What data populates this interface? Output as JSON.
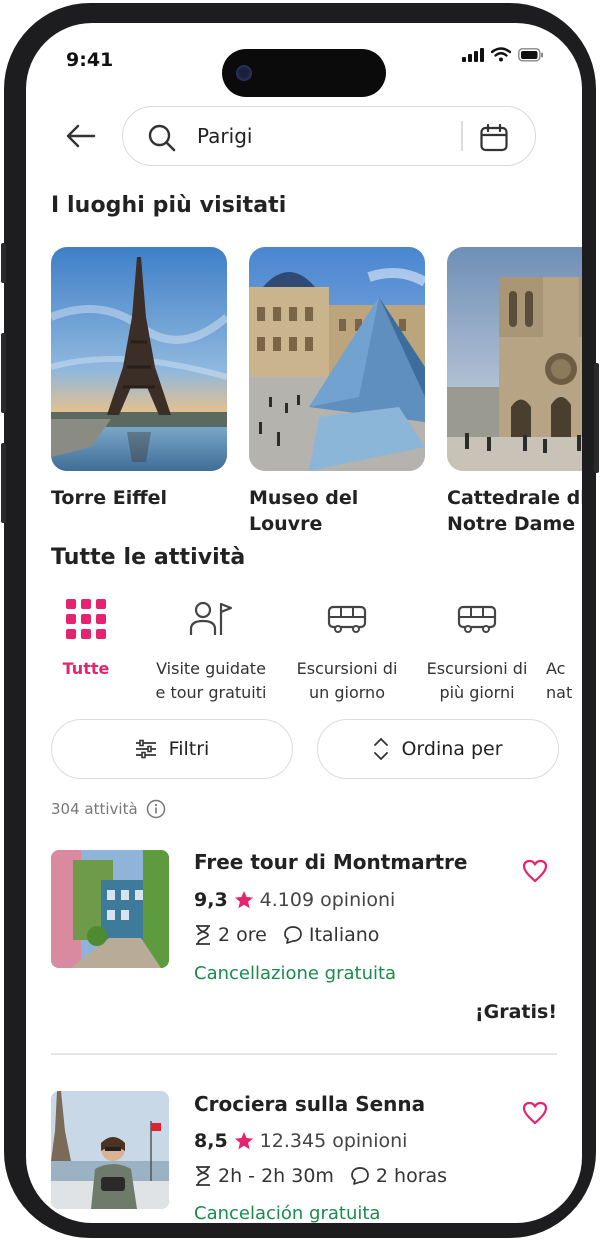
{
  "status_bar": {
    "time": "9:41"
  },
  "search": {
    "query": "Parigi"
  },
  "places_section": {
    "title": "I luoghi più visitati",
    "items": [
      {
        "name_line1": "Torre Eiffel",
        "name_line2": ""
      },
      {
        "name_line1": "Museo del",
        "name_line2": "Louvre"
      },
      {
        "name_line1": "Cattedrale di",
        "name_line2": "Notre Dame"
      }
    ]
  },
  "activities_section": {
    "title": "Tutte le attività",
    "categories": [
      {
        "line1": "Tutte",
        "line2": "",
        "icon": "grid-icon",
        "active": true
      },
      {
        "line1": "Visite guidate",
        "line2": "e tour gratuiti",
        "icon": "guide-flag-icon",
        "active": false
      },
      {
        "line1": "Escursioni di",
        "line2": "un giorno",
        "icon": "bus-icon",
        "active": false
      },
      {
        "line1": "Escursioni di",
        "line2": "più giorni",
        "icon": "bus-icon",
        "active": false
      },
      {
        "line1": "Ac",
        "line2": "nat",
        "icon": "activity-icon",
        "active": false
      }
    ],
    "filters_label": "Filtri",
    "sort_label": "Ordina per",
    "count_text": "304 attività"
  },
  "activities": [
    {
      "title": "Free tour di Montmartre",
      "rating": "9,3",
      "reviews": "4.109 opinioni",
      "duration": "2 ore",
      "language": "Italiano",
      "cancellation": "Cancellazione gratuita",
      "price": "¡Gratis!"
    },
    {
      "title": "Crociera sulla Senna",
      "rating": "8,5",
      "reviews": "12.345 opinioni",
      "duration": "2h - 2h 30m",
      "language": "2 horas",
      "cancellation": "Cancelación gratuita"
    }
  ],
  "colors": {
    "accent": "#e6236f",
    "green": "#1a8a4e",
    "text": "#222222"
  }
}
